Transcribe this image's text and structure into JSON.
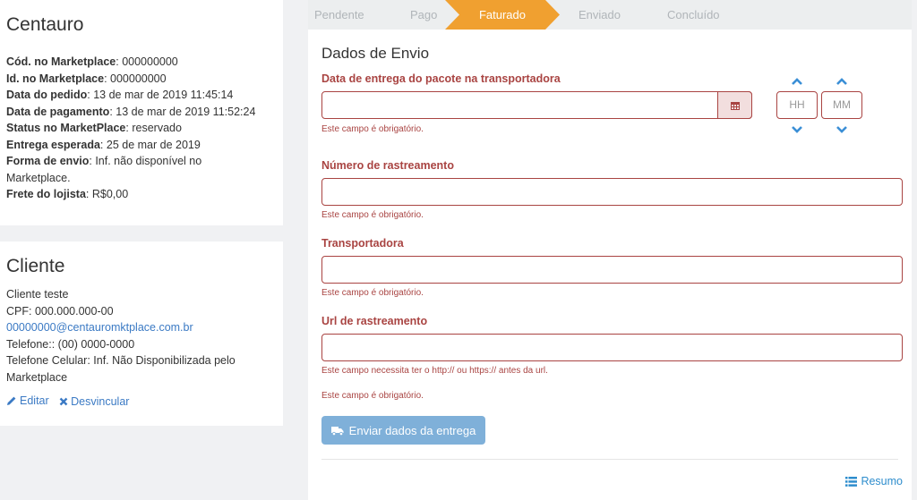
{
  "store": {
    "title": "Centauro",
    "fields": [
      {
        "label": "Cód. no Marketplace",
        "value": ": 000000000"
      },
      {
        "label": "Id. no Marketplace",
        "value": ": 000000000"
      },
      {
        "label": "Data do pedido",
        "value": ": 13 de mar de 2019 11:45:14"
      },
      {
        "label": "Data de pagamento",
        "value": ": 13 de mar de 2019 11:52:24"
      },
      {
        "label": "Status no MarketPlace",
        "value": ": reservado"
      },
      {
        "label": "Entrega esperada",
        "value": ": 25 de mar de 2019"
      },
      {
        "label": "Forma de envio",
        "value": ": Inf. não disponível no Marketplace."
      },
      {
        "label": "Frete do lojista",
        "value": ": R$0,00"
      }
    ]
  },
  "client": {
    "title": "Cliente",
    "name": "Cliente teste",
    "cpf": "CPF: 000.000.000-00",
    "email": "00000000@centauromktplace.com.br",
    "phone": "Telefone:: (00) 0000-0000",
    "cell": "Telefone Celular: Inf. Não Disponibilizada pelo Marketplace",
    "edit_label": "Editar",
    "unlink_label": "Desvincular"
  },
  "stepper": {
    "steps": [
      "Pendente",
      "Pago",
      "Faturado",
      "Enviado",
      "Concluído"
    ],
    "active": "Faturado",
    "active_color": "#f0a030"
  },
  "form": {
    "title": "Dados de Envio",
    "date_label": "Data de entrega do pacote na transportadora",
    "hour_placeholder": "HH",
    "minute_placeholder": "MM",
    "required_error": "Este campo é obrigatório.",
    "tracking_label": "Número de rastreamento",
    "carrier_label": "Transportadora",
    "url_label": "Url de rastreamento",
    "url_error": "Este campo necessita ter o http:// ou https:// antes da url.",
    "send_button": "Enviar dados da entrega",
    "resumo_link": "Resumo"
  },
  "colors": {
    "error": "#a94442",
    "link": "#3b7ac4",
    "button": "#7fb0d9",
    "chevron": "#3b8fd6"
  }
}
